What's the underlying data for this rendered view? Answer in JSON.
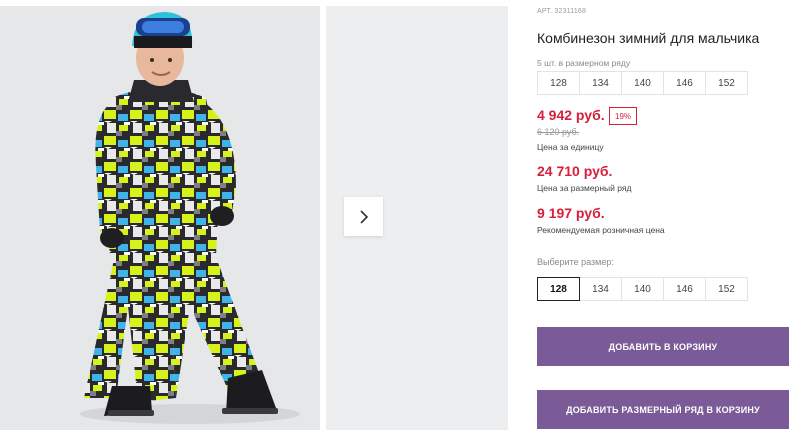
{
  "product": {
    "article": "АРТ. 32311168",
    "title": "Комбинезон зимний для мальчика",
    "size_row_label": "5 шт. в размерном ряду",
    "size_row": [
      "128",
      "134",
      "140",
      "146",
      "152"
    ],
    "price_unit": "4 942 руб.",
    "discount": "19%",
    "old_price": "6 120 руб.",
    "price_unit_caption": "Цена за единицу",
    "price_row": "24 710 руб.",
    "price_row_caption": "Цена за размерный ряд",
    "price_rrp": "9 197 руб.",
    "price_rrp_caption": "Рекомендуемая розничная цена",
    "choose_size_label": "Выберите размер:",
    "selectable_sizes": [
      "128",
      "134",
      "140",
      "146",
      "152"
    ],
    "selected_size": "128"
  },
  "actions": {
    "add_to_cart": "ДОБАВИТЬ В КОРЗИНУ",
    "add_row_to_cart": "ДОБАВИТЬ РАЗМЕРНЫЙ РЯД В КОРЗИНУ"
  },
  "gallery": {
    "next_icon": "chevron-right-icon"
  },
  "colors": {
    "accent": "#7b5a98",
    "price_red": "#d6203a"
  }
}
